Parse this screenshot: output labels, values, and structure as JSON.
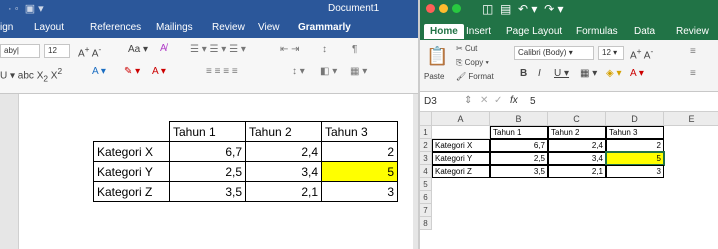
{
  "word": {
    "title": "Document1",
    "tabs": [
      "ign",
      "Layout",
      "References",
      "Mailings",
      "Review",
      "View",
      "Grammarly"
    ],
    "font_name": "aby|",
    "font_size": "12",
    "table": {
      "header": [
        "",
        "Tahun 1",
        "Tahun 2",
        "Tahun 3"
      ],
      "rows": [
        [
          "Kategori X",
          "6,7",
          "2,4",
          "2"
        ],
        [
          "Kategori Y",
          "2,5",
          "3,4",
          "5"
        ],
        [
          "Kategori Z",
          "3,5",
          "2,1",
          "3"
        ]
      ]
    }
  },
  "excel": {
    "tabs": [
      "Home",
      "Insert",
      "Page Layout",
      "Formulas",
      "Data",
      "Review"
    ],
    "clipboard": {
      "cut": "Cut",
      "copy": "Copy",
      "format": "Format",
      "paste": "Paste"
    },
    "font_name": "Calibri (Body)",
    "font_size": "12",
    "name_box": "D3",
    "formula_value": "5",
    "columns": [
      "A",
      "B",
      "C",
      "D",
      "E"
    ],
    "rows": [
      "1",
      "2",
      "3",
      "4",
      "5",
      "6",
      "7",
      "8"
    ],
    "cells": {
      "header": [
        "Tahun 1",
        "Tahun 2",
        "Tahun 3"
      ],
      "data": [
        [
          "Kategori X",
          "6,7",
          "2,4",
          "2"
        ],
        [
          "Kategori Y",
          "2,5",
          "3,4",
          "5"
        ],
        [
          "Kategori Z",
          "3,5",
          "2,1",
          "3"
        ]
      ]
    }
  },
  "colors": {
    "word_blue": "#2b579a",
    "excel_green": "#217346",
    "highlight": "#ffff00"
  }
}
